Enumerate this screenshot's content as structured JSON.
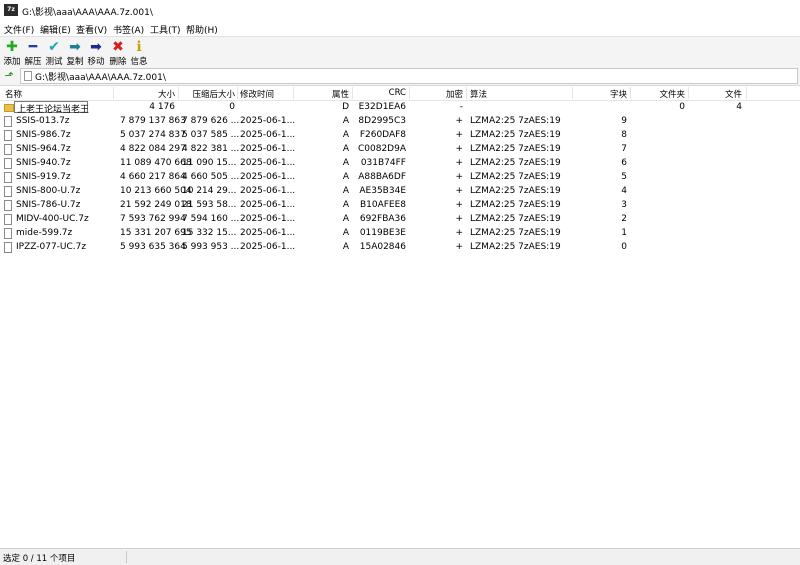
{
  "window": {
    "title": "G:\\影视\\aaa\\AAA\\AAA.7z.001\\",
    "app_icon_text": "7z"
  },
  "menu": [
    "文件(F)",
    "编辑(E)",
    "查看(V)",
    "书签(A)",
    "工具(T)",
    "帮助(H)"
  ],
  "toolbar": [
    {
      "label": "添加",
      "icon": "add-icon",
      "glyph": "✚",
      "color": "#1faa1f"
    },
    {
      "label": "解压",
      "icon": "extract-icon",
      "glyph": "━",
      "color": "#1f3fa8"
    },
    {
      "label": "测试",
      "icon": "test-icon",
      "glyph": "✔",
      "color": "#17a9b5"
    },
    {
      "label": "复制",
      "icon": "copy-icon",
      "glyph": "➡",
      "color": "#1c7f92"
    },
    {
      "label": "移动",
      "icon": "move-icon",
      "glyph": "➡",
      "color": "#1a2b8a"
    },
    {
      "label": "删除",
      "icon": "delete-icon",
      "glyph": "✖",
      "color": "#d62020"
    },
    {
      "label": "信息",
      "icon": "info-icon",
      "glyph": "ℹ",
      "color": "#c7a200"
    }
  ],
  "address": {
    "path": "G:\\影视\\aaa\\AAA\\AAA.7z.001\\"
  },
  "columns": [
    "名称",
    "大小",
    "压缩后大小",
    "修改时间",
    "属性",
    "CRC",
    "加密",
    "算法",
    "字块",
    "文件夹",
    "文件"
  ],
  "rows": [
    {
      "name": "上老王论坛当老王",
      "type": "folder",
      "size": "4 176",
      "packed": "0",
      "mtime": "",
      "attr": "D",
      "crc": "E32D1EA6",
      "enc": "-",
      "method": "",
      "block": "",
      "folders": "0",
      "files": "4"
    },
    {
      "name": "SSIS-013.7z",
      "type": "file",
      "size": "7 879 137 863",
      "packed": "7 879 626 ...",
      "mtime": "2025-06-1...",
      "attr": "A",
      "crc": "8D2995C3",
      "enc": "+",
      "method": "LZMA2:25 7zAES:19",
      "block": "9",
      "folders": "",
      "files": ""
    },
    {
      "name": "SNIS-986.7z",
      "type": "file",
      "size": "5 037 274 837",
      "packed": "5 037 585 ...",
      "mtime": "2025-06-1...",
      "attr": "A",
      "crc": "F260DAF8",
      "enc": "+",
      "method": "LZMA2:25 7zAES:19",
      "block": "8",
      "folders": "",
      "files": ""
    },
    {
      "name": "SNIS-964.7z",
      "type": "file",
      "size": "4 822 084 297",
      "packed": "4 822 381 ...",
      "mtime": "2025-06-1...",
      "attr": "A",
      "crc": "C0082D9A",
      "enc": "+",
      "method": "LZMA2:25 7zAES:19",
      "block": "7",
      "folders": "",
      "files": ""
    },
    {
      "name": "SNIS-940.7z",
      "type": "file",
      "size": "11 089 470 668",
      "packed": "11 090 15...",
      "mtime": "2025-06-1...",
      "attr": "A",
      "crc": "031B74FF",
      "enc": "+",
      "method": "LZMA2:25 7zAES:19",
      "block": "6",
      "folders": "",
      "files": ""
    },
    {
      "name": "SNIS-919.7z",
      "type": "file",
      "size": "4 660 217 864",
      "packed": "4 660 505 ...",
      "mtime": "2025-06-1...",
      "attr": "A",
      "crc": "A88BA6DF",
      "enc": "+",
      "method": "LZMA2:25 7zAES:19",
      "block": "5",
      "folders": "",
      "files": ""
    },
    {
      "name": "SNIS-800-U.7z",
      "type": "file",
      "size": "10 213 660 504",
      "packed": "10 214 29...",
      "mtime": "2025-06-1...",
      "attr": "A",
      "crc": "AE35B34E",
      "enc": "+",
      "method": "LZMA2:25 7zAES:19",
      "block": "4",
      "folders": "",
      "files": ""
    },
    {
      "name": "SNIS-786-U.7z",
      "type": "file",
      "size": "21 592 249 018",
      "packed": "21 593 58...",
      "mtime": "2025-06-1...",
      "attr": "A",
      "crc": "B10AFEE8",
      "enc": "+",
      "method": "LZMA2:25 7zAES:19",
      "block": "3",
      "folders": "",
      "files": ""
    },
    {
      "name": "MIDV-400-UC.7z",
      "type": "file",
      "size": "7 593 762 994",
      "packed": "7 594 160 ...",
      "mtime": "2025-06-1...",
      "attr": "A",
      "crc": "692FBA36",
      "enc": "+",
      "method": "LZMA2:25 7zAES:19",
      "block": "2",
      "folders": "",
      "files": ""
    },
    {
      "name": "mide-599.7z",
      "type": "file",
      "size": "15 331 207 695",
      "packed": "15 332 15...",
      "mtime": "2025-06-1...",
      "attr": "A",
      "crc": "0119BE3E",
      "enc": "+",
      "method": "LZMA2:25 7zAES:19",
      "block": "1",
      "folders": "",
      "files": ""
    },
    {
      "name": "IPZZ-077-UC.7z",
      "type": "file",
      "size": "5 993 635 364",
      "packed": "5 993 953 ...",
      "mtime": "2025-06-1...",
      "attr": "A",
      "crc": "15A02846",
      "enc": "+",
      "method": "LZMA2:25 7zAES:19",
      "block": "0",
      "folders": "",
      "files": ""
    }
  ],
  "status": {
    "text": "选定 0 / 11 个项目"
  }
}
